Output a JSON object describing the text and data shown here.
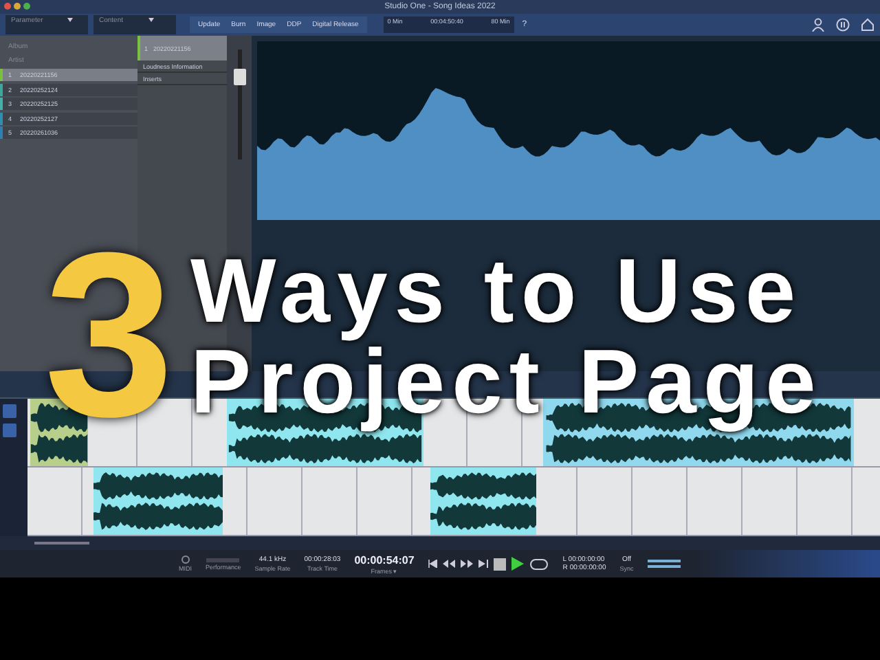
{
  "window": {
    "title": "Studio One - Song Ideas 2022"
  },
  "toolbar": {
    "parameter_label": "Parameter",
    "content_label": "Content",
    "buttons": [
      "Update",
      "Burn",
      "Image",
      "DDP",
      "Digital Release"
    ],
    "timeline": {
      "start": "0 Min",
      "position": "00:04:50:40",
      "end": "80 Min",
      "help": "?"
    }
  },
  "album": {
    "album_placeholder": "Album",
    "artist_placeholder": "Artist",
    "tracks": [
      {
        "number": "1",
        "name": "20220221156",
        "selected": true,
        "color": "#7ac142"
      },
      {
        "number": "2",
        "name": "20220252124",
        "selected": false,
        "color": "#3aa89a"
      },
      {
        "number": "3",
        "name": "20220252125",
        "selected": false,
        "color": "#45b0a8"
      },
      {
        "number": "4",
        "name": "20220252127",
        "selected": false,
        "color": "#2f8fb0"
      },
      {
        "number": "5",
        "name": "20220261036",
        "selected": false,
        "color": "#2f7fb0"
      }
    ]
  },
  "inspector": {
    "track_number": "1",
    "track_name": "20220221156",
    "sections": [
      "Loudness Information",
      "Inserts"
    ]
  },
  "overlay": {
    "number": "3",
    "lines": [
      "Ways to Use",
      "Project Page"
    ]
  },
  "transport": {
    "midi_label": "MIDI",
    "performance_label": "Performance",
    "sample_rate": "44.1 kHz",
    "sample_rate_label": "Sample Rate",
    "track_time": "00:00:28:03",
    "track_time_label": "Track Time",
    "position": "00:00:54:07",
    "position_format": "Frames ▾",
    "playing": true,
    "loop_left_label": "L",
    "loop_left": "00:00:00:00",
    "loop_right_label": "R",
    "loop_right": "00:00:00:00",
    "sync_value": "Off",
    "sync_label": "Sync"
  }
}
